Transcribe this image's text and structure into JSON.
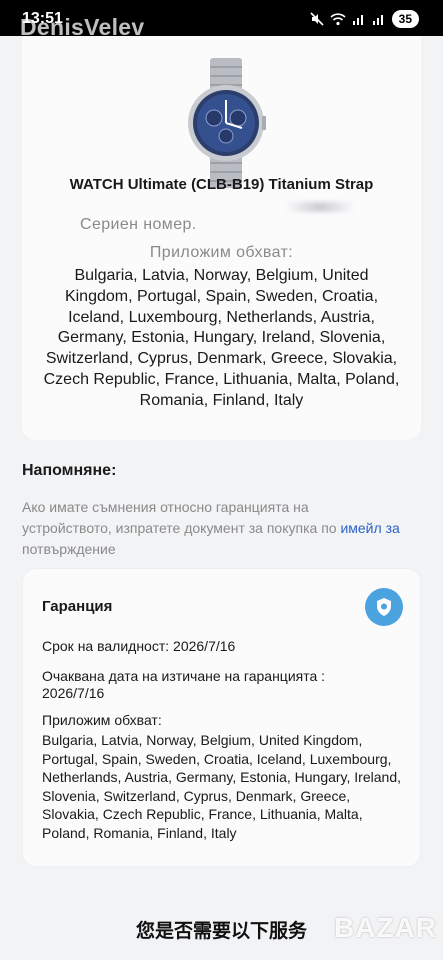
{
  "status_bar": {
    "time": "13:51",
    "battery": "35",
    "icons": [
      "mute-icon",
      "wifi-icon",
      "signal-icon",
      "signal-icon",
      "battery-icon"
    ]
  },
  "watermark_user": "DenisVelev",
  "product": {
    "name": "WATCH Ultimate (CLB-B19) Titanium Strap",
    "serial_label": "Сериен номер.",
    "coverage_label": "Приложим обхват:",
    "coverage_countries": "Bulgaria, Latvia, Norway, Belgium, United Kingdom, Portugal, Spain, Sweden, Croatia, Iceland, Luxembourg, Netherlands, Austria, Germany, Estonia, Hungary, Ireland, Slovenia, Switzerland, Cyprus, Denmark, Greece, Slovakia, Czech Republic, France, Lithuania, Malta, Poland, Romania, Finland, Italy"
  },
  "reminder": {
    "title": "Напомняне:",
    "text_before": "Ако имате съмнения относно гаранцията на устройството, изпратете документ за покупка по ",
    "link": "имейл за",
    "text_after": " потвърждение"
  },
  "warranty": {
    "title": "Гаранция",
    "validity": "Срок на валидност: 2026/7/16",
    "expected_label": "Очаквана дата на изтичане на гаранцията :",
    "expected_date": "2026/7/16",
    "coverage_label": "Приложим обхват:",
    "coverage_countries": "Bulgaria, Latvia, Norway, Belgium, United Kingdom, Portugal, Spain, Sweden, Croatia, Iceland, Luxembourg, Netherlands, Austria, Germany, Estonia, Hungary, Ireland, Slovenia, Switzerland, Cyprus, Denmark, Greece, Slovakia, Czech Republic, France, Lithuania, Malta, Poland, Romania, Finland, Italy",
    "icon": "shield-icon"
  },
  "bottom_banner": "您是否需要以下服务",
  "bazar_logo": "BAZAR"
}
